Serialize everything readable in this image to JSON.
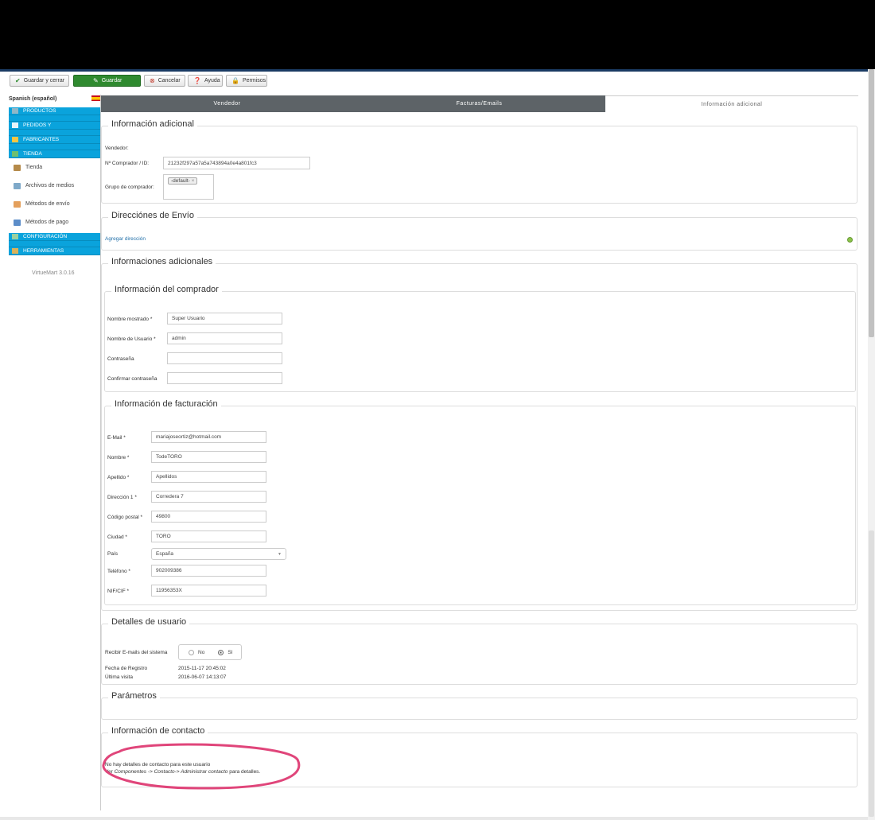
{
  "toolbar": {
    "save_close": "Guardar y cerrar",
    "save": "Guardar",
    "cancel": "Cancelar",
    "help": "Ayuda",
    "permissions": "Permisos"
  },
  "sidebar": {
    "language": "Spanish (español)",
    "items": [
      {
        "label": "PRODUCTOS"
      },
      {
        "label": "PEDIDOS Y"
      },
      {
        "label": "FABRICANTES"
      },
      {
        "label": "TIENDA"
      },
      {
        "label": "Tienda"
      },
      {
        "label": "Archivos de medios"
      },
      {
        "label": "Métodos de envío"
      },
      {
        "label": "Métodos de pago"
      },
      {
        "label": "CONFIGURACIÓN"
      },
      {
        "label": "HERRAMIENTAS"
      }
    ],
    "version": "VirtueMart 3.0.16"
  },
  "tabs": {
    "vendor": "Vendedor",
    "invoices": "Facturas/Emails",
    "additional": "Información adicional"
  },
  "info": {
    "legend": "Información adicional",
    "vendor_label": "Vendedor:",
    "buyer_id_label": "Nº Comprador / ID:",
    "buyer_id_value": "21232f297a57a5a743894a0e4a801fc3",
    "group_label": "Grupo de comprador:",
    "group_tag": "-default-"
  },
  "shipping": {
    "legend": "Direcciónes de Envío",
    "add_link": "Agregar dirección"
  },
  "additional": {
    "legend": "Informaciones adicionales",
    "buyer": {
      "legend": "Información del comprador",
      "display_name_label": "Nombre mostrado *",
      "display_name_value": "Super Usuario",
      "username_label": "Nombre de Usuario *",
      "username_value": "admin",
      "password_label": "Contraseña",
      "confirm_label": "Confirmar contraseña"
    },
    "billing": {
      "legend": "Información de facturación",
      "email_label": "E-Mail *",
      "email_value": "mariajoseortiz@hotmail.com",
      "name_label": "Nombre *",
      "name_value": "TodeTORO",
      "surname_label": "Apellido *",
      "surname_value": "Apellidos",
      "address_label": "Dirección 1 *",
      "address_value": "Corredera 7",
      "zip_label": "Código postal *",
      "zip_value": "49800",
      "city_label": "Ciudad *",
      "city_value": "TORO",
      "country_label": "País",
      "country_value": "España",
      "phone_label": "Teléfono *",
      "phone_value": "902009386",
      "nif_label": "NIF/CIF *",
      "nif_value": "11956353X"
    }
  },
  "user": {
    "legend": "Detalles de usuario",
    "emails_label": "Recibir E-mails del sistema",
    "no": "No",
    "yes": "SI",
    "reg_label": "Fecha de Registro",
    "reg_value": "2015-11-17 20:45:02",
    "last_label": "Última visita",
    "last_value": "2016-06-07 14:13:07"
  },
  "params": {
    "legend": "Parámetros"
  },
  "contact": {
    "legend": "Información de contacto",
    "line1": "No hay detalles de contacto para este usuario",
    "line2_prefix": "Ver ",
    "line2_path": "Componentes -> Contacto-> Administrar contacto",
    "line2_suffix": " para detalles."
  },
  "colors": {
    "nav_blue": "#0aa3dc",
    "save_green": "#2f8a2f",
    "tab_dark": "#5d6367",
    "annotation": "#e0457a"
  }
}
